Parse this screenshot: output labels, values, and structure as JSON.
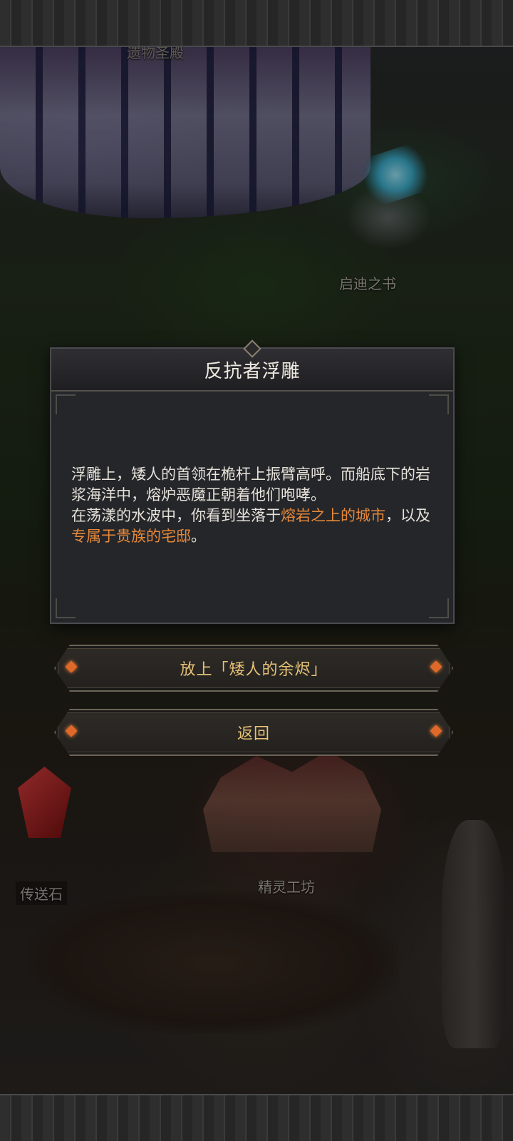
{
  "map": {
    "labels": {
      "relic_hall": "遗物圣殿",
      "book_of_kindi": "启迪之书",
      "teleport_stone": "传送石",
      "elf_workshop": "精灵工坊"
    }
  },
  "dialog": {
    "title": "反抗者浮雕",
    "body": {
      "line1": "浮雕上，矮人的首领在桅杆上振臂高呼。而船底下的岩浆海洋中，熔炉恶魔正朝着他们咆哮。",
      "line2_prefix": "在荡漾的水波中，你看到坐落于",
      "highlight1": "熔岩之上的城市",
      "line2_mid": "，以及",
      "highlight2": "专属于贵族的宅邸",
      "line2_suffix": "。"
    }
  },
  "buttons": {
    "place_label": "放上「矮人的余烬」",
    "back_label": "返回"
  },
  "colors": {
    "highlight": "#e7893a",
    "button_text": "#e6c277",
    "dialog_bg": "#25262a"
  }
}
